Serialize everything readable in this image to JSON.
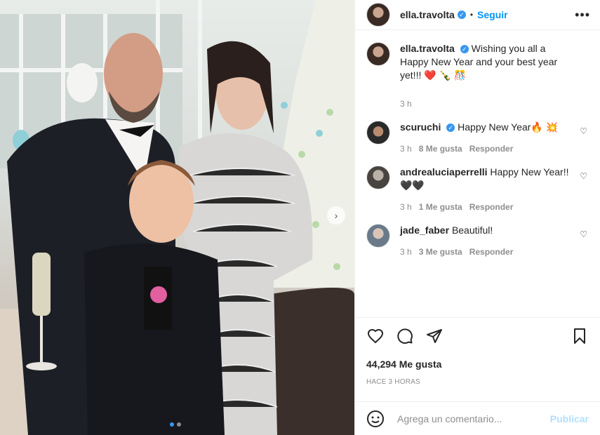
{
  "header": {
    "username": "ella.travolta",
    "separator": "•",
    "follow_label": "Seguir",
    "more_label": "•••"
  },
  "caption": {
    "username": "ella.travolta",
    "text": "Wishing you all a Happy New Year and your best year yet!!! ❤️ 🍾 🎊",
    "time": "3 h"
  },
  "comments": [
    {
      "username": "scuruchi",
      "verified": true,
      "text": "Happy New Year🔥 💥",
      "time": "3 h",
      "likes": "8 Me gusta",
      "reply": "Responder"
    },
    {
      "username": "andrealuciaperrelli",
      "verified": false,
      "text": "Happy New Year!! 🖤🖤",
      "time": "3 h",
      "likes": "1 Me gusta",
      "reply": "Responder"
    },
    {
      "username": "jade_faber",
      "verified": false,
      "text": "Beautiful!",
      "time": "3 h",
      "likes": "3 Me gusta",
      "reply": "Responder"
    }
  ],
  "actions": {
    "likes_count": "44,294 Me gusta",
    "timestamp": "HACE 3 HORAS"
  },
  "comment_box": {
    "placeholder": "Agrega un comentario...",
    "post_label": "Publicar"
  },
  "colors": {
    "accent": "#0095f6",
    "verified": "#3897f0"
  },
  "icons": [
    "heart-icon",
    "comment-icon",
    "share-icon",
    "bookmark-icon",
    "emoji-icon",
    "verified-icon",
    "chevron-right-icon"
  ]
}
